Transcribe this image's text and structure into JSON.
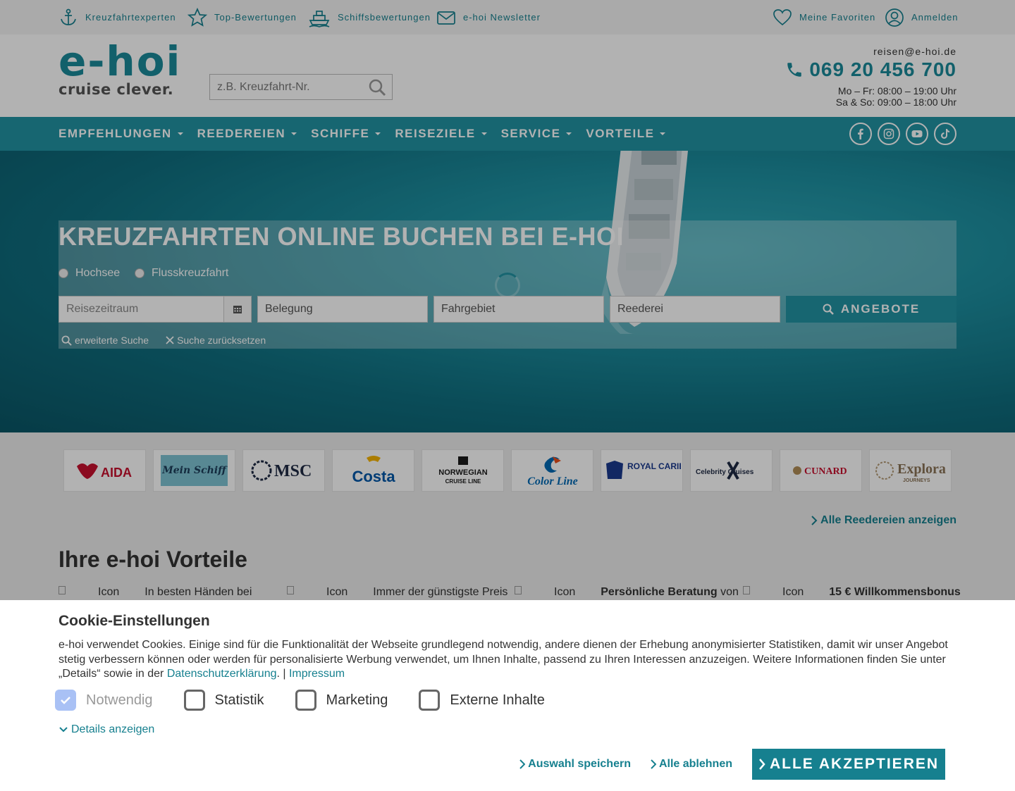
{
  "topbar": {
    "left": [
      {
        "label": "Kreuzfahrtexperten",
        "icon": "anchor-icon"
      },
      {
        "label": "Top-Bewertungen",
        "icon": "star-icon"
      },
      {
        "label": "Schiffsbewertungen",
        "icon": "ship-icon"
      },
      {
        "label": "e-hoi Newsletter",
        "icon": "mail-icon"
      }
    ],
    "right": [
      {
        "label": "Meine Favoriten",
        "icon": "heart-icon"
      },
      {
        "label": "Anmelden",
        "icon": "user-icon"
      }
    ]
  },
  "header": {
    "logo_main": "e-hoi",
    "logo_tagline": "cruise clever.",
    "search_placeholder": "z.B. Kreuzfahrt-Nr.",
    "email": "reisen@e-hoi.de",
    "phone": "069 20 456 700",
    "hours_weekday": "Mo – Fr: 08:00 – 19:00 Uhr",
    "hours_weekend": "Sa & So: 09:00 – 18:00 Uhr"
  },
  "nav": {
    "items": [
      "EMPFEHLUNGEN",
      "REEDEREIEN",
      "SCHIFFE",
      "REISEZIELE",
      "SERVICE",
      "VORTEILE"
    ],
    "social": [
      "facebook-icon",
      "instagram-icon",
      "youtube-icon",
      "tiktok-icon"
    ]
  },
  "hero": {
    "title": "KREUZFAHRTEN ONLINE BUCHEN BEI E-HOI",
    "radio_sea": "Hochsee",
    "radio_river": "Flusskreuzfahrt",
    "field_period": "Reisezeitraum",
    "field_occupancy": "Belegung",
    "field_area": "Fahrgebiet",
    "field_line": "Reederei",
    "offers_button": "ANGEBOTE",
    "advanced_search": "erweiterte Suche",
    "reset_search": "Suche zurücksetzen"
  },
  "cruise_lines": [
    "AIDA",
    "Mein Schiff",
    "MSC",
    "Costa",
    "NORWEGIAN",
    "Color Line",
    "ROYAL CARIBBEAN",
    "Celebrity Cruises",
    "CUNARD",
    "Explora"
  ],
  "all_lines_link": "Alle Reedereien anzeigen",
  "benefits": {
    "title": "Ihre e-hoi Vorteile",
    "icon_alt": "Icon",
    "items": [
      {
        "pre": "In besten Händen bei",
        "bold": ""
      },
      {
        "pre": "Immer der günstigste Preis",
        "bold": ""
      },
      {
        "pre": " von",
        "bold": "Persönliche Beratung"
      },
      {
        "pre": "",
        "bold": "15 € Willkommensbonus"
      }
    ]
  },
  "cookie": {
    "title": "Cookie-Einstellungen",
    "text": "e-hoi verwendet Cookies. Einige sind für die Funktionalität der Webseite grundlegend notwendig, andere dienen der Erhebung anonymisierter Statistiken, damit wir unser Angebot stetig verbessern können oder werden für personalisierte Werbung verwendet, um Ihnen Inhalte, passend zu Ihren Interessen anzuzeigen. Weitere Informationen finden Sie unter „Details“ sowie in der",
    "privacy_link": "Datenschutzerklärung",
    "separator": ". |",
    "imprint_link": "Impressum",
    "checks": [
      {
        "label": "Notwendig",
        "checked": true
      },
      {
        "label": "Statistik",
        "checked": false
      },
      {
        "label": "Marketing",
        "checked": false
      },
      {
        "label": "Externe Inhalte",
        "checked": false
      }
    ],
    "details_link": "Details anzeigen",
    "save_label": "Auswahl speichern",
    "reject_label": "Alle ablehnen",
    "accept_label": "ALLE AKZEPTIEREN"
  },
  "colors": {
    "accent": "#2193a3",
    "link": "#16808f",
    "logo": "#1a8a9a"
  }
}
